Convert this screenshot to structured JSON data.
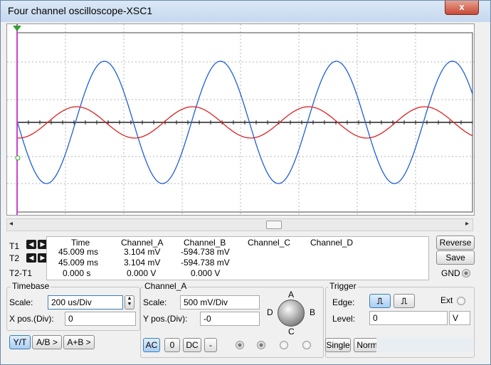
{
  "window": {
    "title": "Four channel oscilloscope-XSC1",
    "close_label": "x"
  },
  "screen": {
    "channel_a_color": "#dd2222",
    "channel_b_color": "#1e5fd6",
    "trigger_marker_color": "#cc44cc",
    "cursor_marker_color": "#2aa52a"
  },
  "scrollbar": {
    "left_arrow": "◂",
    "right_arrow": "▸"
  },
  "cursors": {
    "t1": "T1",
    "t2": "T2",
    "t2_t1": "T2-T1"
  },
  "readout": {
    "headers": [
      "Time",
      "Channel_A",
      "Channel_B",
      "Channel_C",
      "Channel_D"
    ],
    "rows": [
      {
        "time": "45.009 ms",
        "a": "3.104 mV",
        "b": "-594.738 mV"
      },
      {
        "time": "45.009 ms",
        "a": "3.104 mV",
        "b": "-594.738 mV"
      },
      {
        "time": "0.000 s",
        "a": "0.000 V",
        "b": "0.000 V"
      }
    ]
  },
  "right_buttons": {
    "reverse": "Reverse",
    "save": "Save",
    "gnd": "GND"
  },
  "timebase": {
    "title": "Timebase",
    "scale_label": "Scale:",
    "scale_value": "200 us/Div",
    "xpos_label": "X pos.(Div):",
    "xpos_value": "0",
    "modes": [
      "Y/T",
      "A/B >",
      "A+B >"
    ]
  },
  "channel": {
    "title": "Channel_A",
    "scale_label": "Scale:",
    "scale_value": "500 mV/Div",
    "ypos_label": "Y pos.(Div):",
    "ypos_value": "-0",
    "coupling": [
      "AC",
      "0",
      "DC",
      "-"
    ],
    "selector_labels": {
      "a": "A",
      "b": "B",
      "c": "C",
      "d": "D"
    }
  },
  "trigger": {
    "title": "Trigger",
    "edge_label": "Edge:",
    "ext_label": "Ext",
    "level_label": "Level:",
    "level_value": "0",
    "level_unit": "V",
    "modes": [
      "Single",
      "Norm"
    ]
  }
}
